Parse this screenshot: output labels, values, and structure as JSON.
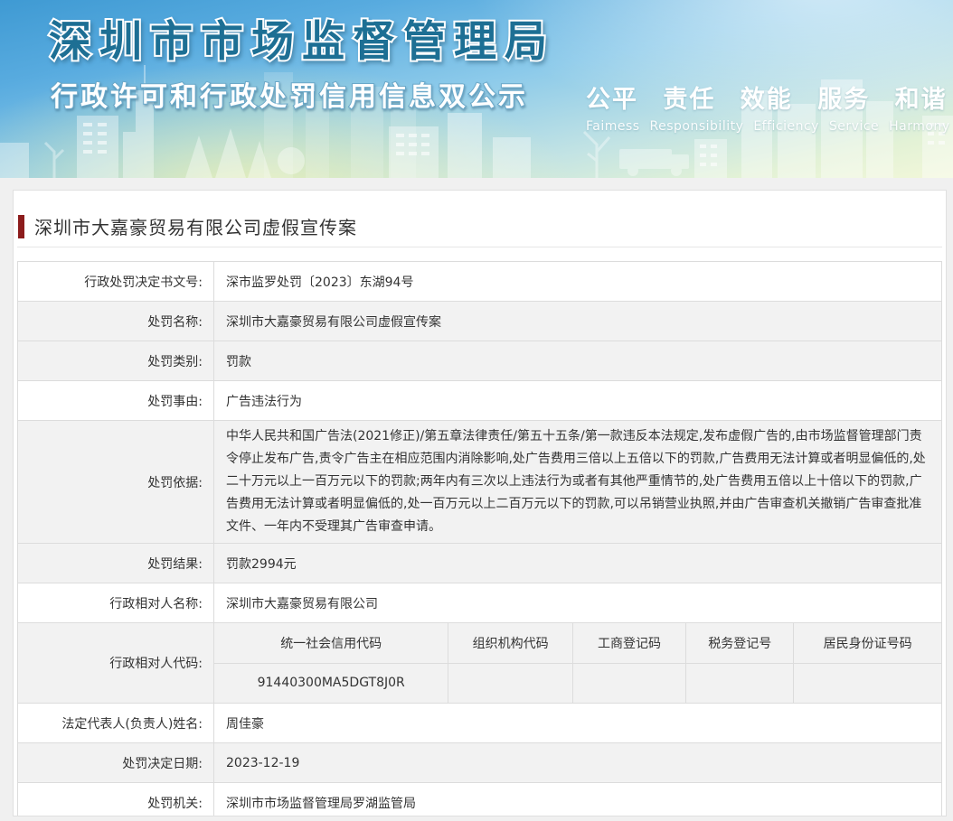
{
  "colors": {
    "accent": "#8c1c1c",
    "titleFill": "#1d6f94",
    "rowShade": "#f2f2f2",
    "tblBorder": "#dcdcdc"
  },
  "header": {
    "org_name": "深圳市市场监督管理局",
    "banner_subtitle": "行政许可和行政处罚信用信息双公示",
    "slogan_cn": "公平 责任 效能 服务 和谐",
    "slogan_en": "Faimess Responsibility Efficiency Service Harmony"
  },
  "page": {
    "title": "深圳市大嘉豪贸易有限公司虚假宣传案"
  },
  "table": {
    "rows": [
      {
        "label": "行政处罚决定书文号:",
        "value": "深市监罗处罚〔2023〕东湖94号"
      },
      {
        "label": "处罚名称:",
        "value": "深圳市大嘉豪贸易有限公司虚假宣传案"
      },
      {
        "label": "处罚类别:",
        "value": "罚款"
      },
      {
        "label": "处罚事由:",
        "value": "广告违法行为"
      },
      {
        "label": "处罚依据:",
        "value": "中华人民共和国广告法(2021修正)/第五章法律责任/第五十五条/第一款违反本法规定,发布虚假广告的,由市场监督管理部门责令停止发布广告,责令广告主在相应范围内消除影响,处广告费用三倍以上五倍以下的罚款,广告费用无法计算或者明显偏低的,处二十万元以上一百万元以下的罚款;两年内有三次以上违法行为或者有其他严重情节的,处广告费用五倍以上十倍以下的罚款,广告费用无法计算或者明显偏低的,处一百万元以上二百万元以下的罚款,可以吊销营业执照,并由广告审查机关撤销广告审查批准文件、一年内不受理其广告审查申请。"
      },
      {
        "label": "处罚结果:",
        "value": "罚款2994元"
      },
      {
        "label": "行政相对人名称:",
        "value": "深圳市大嘉豪贸易有限公司"
      },
      {
        "label": "法定代表人(负责人)姓名:",
        "value": "周佳豪"
      },
      {
        "label": "处罚决定日期:",
        "value": "2023-12-19"
      },
      {
        "label": "处罚机关:",
        "value": "深圳市市场监督管理局罗湖监管局"
      }
    ],
    "code_row": {
      "label": "行政相对人代码:",
      "columns": [
        "统一社会信用代码",
        "组织机构代码",
        "工商登记码",
        "税务登记号",
        "居民身份证号码"
      ],
      "values": [
        "91440300MA5DGT8J0R",
        "",
        "",
        "",
        ""
      ]
    }
  }
}
